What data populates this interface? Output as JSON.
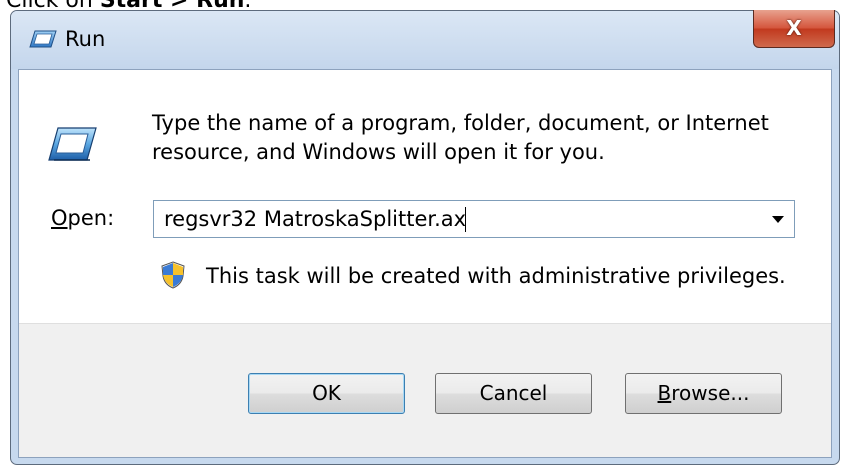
{
  "caption": {
    "prefix": "Click on ",
    "bold": "Start > Run",
    "suffix": "."
  },
  "window": {
    "title": "Run",
    "close_label": "X"
  },
  "dialog": {
    "description": "Type the name of a program, folder, document, or Internet resource, and Windows will open it for you.",
    "open_label_accel": "O",
    "open_label_rest": "pen:",
    "command_value": "regsvr32 MatroskaSplitter.ax",
    "admin_note": "This task will be created with administrative privileges."
  },
  "buttons": {
    "ok": "OK",
    "cancel": "Cancel",
    "browse_accel": "B",
    "browse_rest": "rowse..."
  },
  "icons": {
    "title": "run-dialog-icon",
    "content": "run-program-icon",
    "uac": "uac-shield-icon",
    "close": "close-icon",
    "dropdown": "chevron-down-icon"
  },
  "colors": {
    "title_bar": "#c7d9ee",
    "close_button": "#c8452a",
    "footer": "#f0f0f0",
    "ok_border": "#3c7fb1"
  }
}
